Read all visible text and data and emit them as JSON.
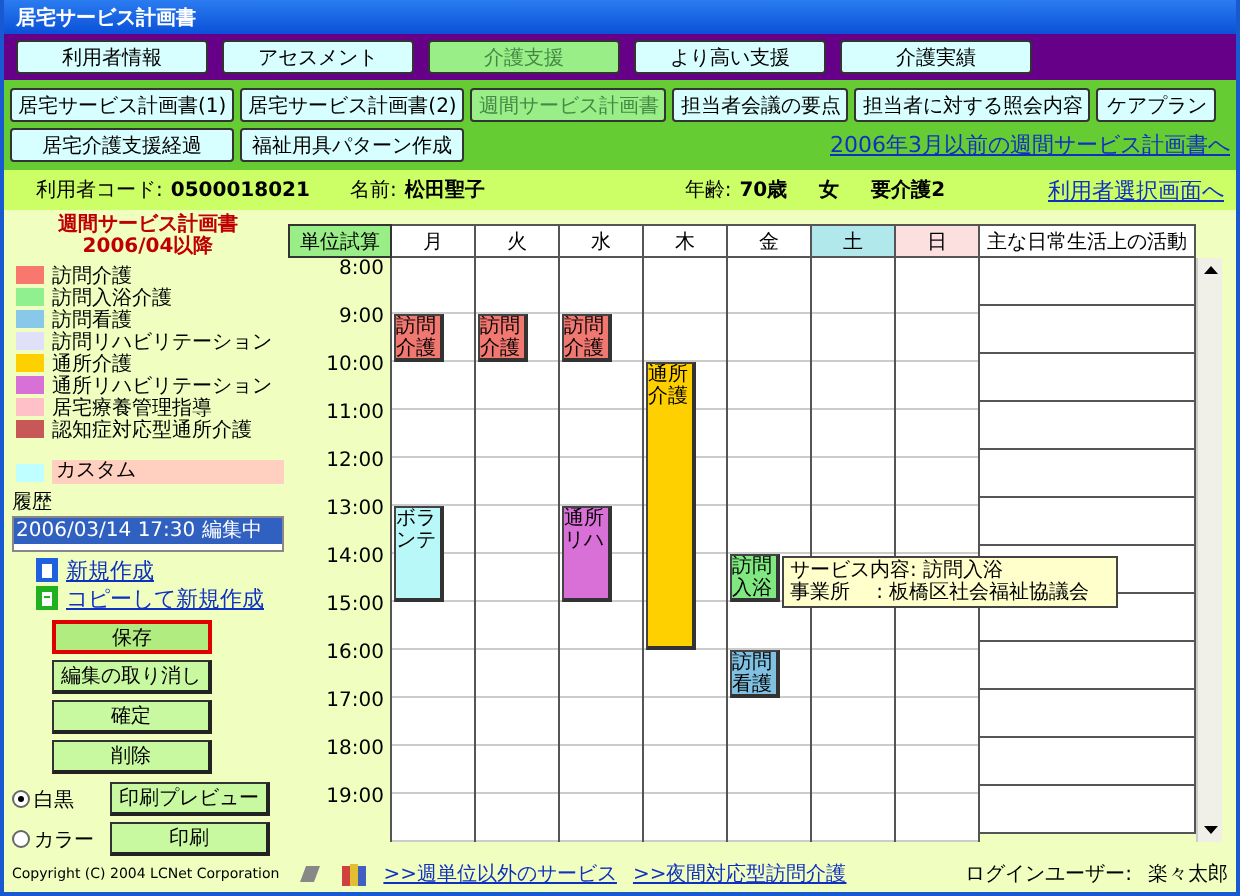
{
  "window": {
    "title": "居宅サービス計画書"
  },
  "main_tabs": [
    {
      "label": "利用者情報",
      "selected": false
    },
    {
      "label": "アセスメント",
      "selected": false
    },
    {
      "label": "介護支援",
      "selected": true
    },
    {
      "label": "より高い支援",
      "selected": false
    },
    {
      "label": "介護実績",
      "selected": false
    }
  ],
  "sub_tabs": [
    {
      "label": "居宅サービス計画書(1)",
      "selected": false
    },
    {
      "label": "居宅サービス計画書(2)",
      "selected": false
    },
    {
      "label": "週間サービス計画書",
      "selected": true
    },
    {
      "label": "担当者会議の要点",
      "selected": false
    },
    {
      "label": "担当者に対する照会内容",
      "selected": false
    },
    {
      "label": "ケアプラン",
      "selected": false
    },
    {
      "label": "居宅介護支援経過",
      "selected": false
    },
    {
      "label": "福祉用具パターン作成",
      "selected": false
    }
  ],
  "old_plan_link": "2006年3月以前の週間サービス計画書へ",
  "user_info": {
    "code_label": "利用者コード:",
    "code": "0500018021",
    "name_label": "名前:",
    "name": "松田聖子",
    "age_label": "年齢:",
    "age": "70歳",
    "sex": "女",
    "care_level": "要介護2",
    "select_link": "利用者選択画面へ"
  },
  "sidebar": {
    "title": "週間サービス計画書",
    "subtitle": "2006/04以降",
    "legend": [
      {
        "label": "訪問介護",
        "color": "#f87870"
      },
      {
        "label": "訪問入浴介護",
        "color": "#90f090"
      },
      {
        "label": "訪問看護",
        "color": "#88c8e8"
      },
      {
        "label": "訪問リハビリテーション",
        "color": "#e0e0f8"
      },
      {
        "label": "通所介護",
        "color": "#ffd000"
      },
      {
        "label": "通所リハビリテーション",
        "color": "#d870d8"
      },
      {
        "label": "居宅療養管理指導",
        "color": "#ffc0c8"
      },
      {
        "label": "認知症対応型通所介護",
        "color": "#c85858"
      }
    ],
    "custom": {
      "label": "カスタム",
      "color": "#c0ffff"
    },
    "history_label": "履歴",
    "history": [
      {
        "label": "2006/03/14 17:30 編集中",
        "selected": true
      }
    ],
    "links": [
      {
        "label": "新規作成",
        "kind": "new"
      },
      {
        "label": "コピーして新規作成",
        "kind": "copy"
      }
    ],
    "buttons": [
      {
        "label": "保存",
        "selected": true
      },
      {
        "label": "編集の取り消し",
        "selected": false
      },
      {
        "label": "確定",
        "selected": false
      },
      {
        "label": "削除",
        "selected": false
      }
    ],
    "print_options": [
      {
        "label": "白黒",
        "selected": true,
        "button": "印刷プレビュー"
      },
      {
        "label": "カラー",
        "selected": false,
        "button": "印刷"
      }
    ]
  },
  "schedule": {
    "calc_button": "単位試算",
    "days": [
      {
        "label": "月",
        "color": "#ffffff"
      },
      {
        "label": "火",
        "color": "#ffffff"
      },
      {
        "label": "水",
        "color": "#ffffff"
      },
      {
        "label": "木",
        "color": "#ffffff"
      },
      {
        "label": "金",
        "color": "#ffffff"
      },
      {
        "label": "土",
        "color": "#b0e8ec"
      },
      {
        "label": "日",
        "color": "#fce0e0"
      }
    ],
    "activity_header": "主な日常生活上の活動",
    "rows": [
      {
        "time": "8:00",
        "cells": [
          null,
          null,
          null,
          null,
          null,
          null,
          null
        ]
      },
      {
        "time": "9:00",
        "cells": [
          {
            "kind": "start",
            "label": "訪問介護",
            "color": "#f07870"
          },
          {
            "kind": "start",
            "label": "訪問介護",
            "color": "#f07870"
          },
          {
            "kind": "start",
            "label": "訪問介護",
            "color": "#f07870"
          },
          null,
          null,
          null,
          null
        ]
      },
      {
        "time": "10:00",
        "cells": [
          null,
          null,
          null,
          {
            "kind": "start",
            "label": "通所介護",
            "color": "#ffd000"
          },
          null,
          null,
          null
        ]
      },
      {
        "time": "11:00",
        "cells": [
          null,
          null,
          null,
          {
            "kind": "cont"
          },
          null,
          null,
          null
        ]
      },
      {
        "time": "12:00",
        "cells": [
          null,
          null,
          null,
          {
            "kind": "cont"
          },
          null,
          null,
          null
        ]
      },
      {
        "time": "13:00",
        "cells": [
          {
            "kind": "start",
            "label": "ボランテ",
            "color": "#b8f8f8"
          },
          null,
          {
            "kind": "start",
            "label": "通所リハ",
            "color": "#d870d8"
          },
          {
            "kind": "cont"
          },
          null,
          null,
          null
        ]
      },
      {
        "time": "14:00",
        "cells": [
          {
            "kind": "cont"
          },
          null,
          {
            "kind": "cont"
          },
          {
            "kind": "cont"
          },
          {
            "kind": "start",
            "label": "訪問入浴",
            "color": "#80e880",
            "tooltip": [
              "サービス内容: 訪問入浴",
              "事業所　 : 板橋区社会福祉協議会"
            ]
          },
          null,
          null
        ]
      },
      {
        "time": "15:00",
        "cells": [
          null,
          null,
          null,
          {
            "kind": "cont"
          },
          null,
          null,
          null
        ]
      },
      {
        "time": "16:00",
        "cells": [
          null,
          null,
          null,
          null,
          {
            "kind": "start",
            "label": "訪問看護",
            "color": "#80c0e0"
          },
          null,
          null
        ]
      },
      {
        "time": "17:00",
        "cells": [
          null,
          null,
          null,
          null,
          null,
          null,
          null
        ]
      },
      {
        "time": "18:00",
        "cells": [
          null,
          null,
          null,
          null,
          null,
          null,
          null
        ]
      },
      {
        "time": "19:00",
        "cells": [
          null,
          null,
          null,
          null,
          null,
          null,
          null
        ]
      }
    ]
  },
  "footer": {
    "copyright": "Copyright (C) 2004 LCNet Corporation",
    "links": [
      ">>週単位以外のサービス",
      ">>夜間対応型訪問介護"
    ],
    "login_label": "ログインユーザー:",
    "login_user": "楽々太郎"
  }
}
